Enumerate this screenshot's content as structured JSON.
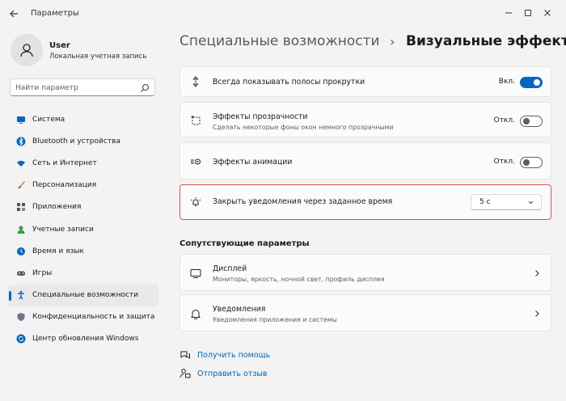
{
  "window": {
    "title": "Параметры"
  },
  "user": {
    "name": "User",
    "account": "Локальная учетная запись"
  },
  "search": {
    "placeholder": "Найти параметр"
  },
  "nav": [
    {
      "label": "Система",
      "icon": "monitor-icon",
      "color": "#0067c0"
    },
    {
      "label": "Bluetooth и устройства",
      "icon": "bluetooth-icon",
      "color": "#0067c0"
    },
    {
      "label": "Сеть и Интернет",
      "icon": "wifi-icon",
      "color": "#0067c0"
    },
    {
      "label": "Персонализация",
      "icon": "brush-icon",
      "color": "#e07a2c"
    },
    {
      "label": "Приложения",
      "icon": "apps-icon",
      "color": "#4a5a6a"
    },
    {
      "label": "Учетные записи",
      "icon": "person-icon",
      "color": "#2ea043"
    },
    {
      "label": "Время и язык",
      "icon": "globe-clock-icon",
      "color": "#0067c0"
    },
    {
      "label": "Игры",
      "icon": "gamepad-icon",
      "color": "#555555"
    },
    {
      "label": "Специальные возможности",
      "icon": "accessibility-icon",
      "color": "#0067c0",
      "active": true
    },
    {
      "label": "Конфиденциальность и защита",
      "icon": "shield-icon",
      "color": "#6b7785"
    },
    {
      "label": "Центр обновления Windows",
      "icon": "update-icon",
      "color": "#0067c0"
    }
  ],
  "header": {
    "breadcrumb": "Специальные возможности",
    "separator": "›",
    "title": "Визуальные эффекты"
  },
  "settings": {
    "scrollbars": {
      "title": "Всегда показывать полосы прокрутки",
      "state": "Вкл."
    },
    "transparency": {
      "title": "Эффекты прозрачности",
      "subtitle": "Сделать некоторые фоны окон немного прозрачными",
      "state": "Откл."
    },
    "animation": {
      "title": "Эффекты анимации",
      "state": "Откл."
    },
    "notifications_timeout": {
      "title": "Закрыть уведомления через заданное время",
      "value": "5 с"
    }
  },
  "related": {
    "title": "Сопутствующие параметры",
    "display": {
      "title": "Дисплей",
      "subtitle": "Мониторы, яркость, ночной свет, профиль дисплея"
    },
    "notifications": {
      "title": "Уведомления",
      "subtitle": "Уведомления приложения и системы"
    }
  },
  "links": {
    "help": "Получить помощь",
    "feedback": "Отправить отзыв"
  },
  "colors": {
    "accent": "#0067c0",
    "highlight_border": "#d9534f"
  }
}
